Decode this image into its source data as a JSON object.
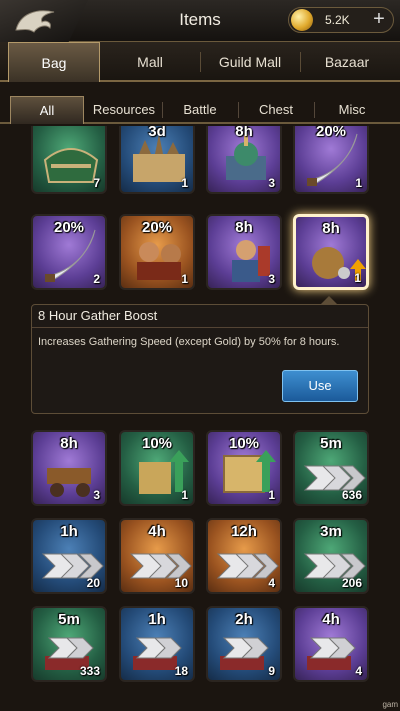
{
  "header": {
    "title": "Items",
    "gold": "5.2K",
    "plus_icon": "plus-icon",
    "logo_icon": "dragon-logo"
  },
  "main_tabs": [
    {
      "label": "Bag",
      "active": true
    },
    {
      "label": "Mall",
      "active": false
    },
    {
      "label": "Guild Mall",
      "active": false
    },
    {
      "label": "Bazaar",
      "active": false
    }
  ],
  "sub_tabs": [
    {
      "label": "All",
      "active": true
    },
    {
      "label": "Resources",
      "active": false
    },
    {
      "label": "Battle",
      "active": false
    },
    {
      "label": "Chest",
      "active": false
    },
    {
      "label": "Misc",
      "active": false
    }
  ],
  "rows": [
    [
      {
        "label": "",
        "count": "7",
        "color": "green",
        "icon": "chest-icon"
      },
      {
        "label": "3d",
        "count": "1",
        "color": "blue",
        "icon": "city-map-icon"
      },
      {
        "label": "8h",
        "count": "3",
        "color": "purple",
        "icon": "mosque-icon"
      },
      {
        "label": "20%",
        "count": "1",
        "color": "purple",
        "icon": "scimitar-icon"
      }
    ],
    [
      {
        "label": "20%",
        "count": "2",
        "color": "purple",
        "icon": "scimitar-icon"
      },
      {
        "label": "20%",
        "count": "1",
        "color": "orange",
        "icon": "soldiers-icon"
      },
      {
        "label": "8h",
        "count": "3",
        "color": "purple",
        "icon": "warrior-icon"
      },
      {
        "label": "8h",
        "count": "1",
        "color": "purple",
        "icon": "resource-sack-icon",
        "selected": true
      }
    ],
    [
      {
        "label": "8h",
        "count": "3",
        "color": "purple",
        "icon": "cart-icon"
      },
      {
        "label": "10%",
        "count": "1",
        "color": "green",
        "icon": "city-upgrade-icon"
      },
      {
        "label": "10%",
        "count": "1",
        "color": "purple",
        "icon": "book-icon"
      },
      {
        "label": "5m",
        "count": "636",
        "color": "green",
        "icon": "speedup-arrows-icon"
      }
    ],
    [
      {
        "label": "1h",
        "count": "20",
        "color": "blue",
        "icon": "speedup-arrows-icon"
      },
      {
        "label": "4h",
        "count": "10",
        "color": "orange",
        "icon": "speedup-arrows-icon"
      },
      {
        "label": "12h",
        "count": "4",
        "color": "orange",
        "icon": "speedup-arrows-icon"
      },
      {
        "label": "3m",
        "count": "206",
        "color": "green",
        "icon": "speedup-arrows-icon"
      }
    ],
    [
      {
        "label": "5m",
        "count": "333",
        "color": "green",
        "icon": "speedup-book-icon"
      },
      {
        "label": "1h",
        "count": "18",
        "color": "blue",
        "icon": "speedup-book-icon"
      },
      {
        "label": "2h",
        "count": "9",
        "color": "blue",
        "icon": "speedup-book-icon"
      },
      {
        "label": "4h",
        "count": "4",
        "color": "purple",
        "icon": "speedup-book-icon"
      }
    ]
  ],
  "detail": {
    "title": "8 Hour Gather Boost",
    "description": "Increases Gathering Speed (except Gold) by 50% for 8 hours.",
    "use_label": "Use"
  },
  "watermark": "gam"
}
